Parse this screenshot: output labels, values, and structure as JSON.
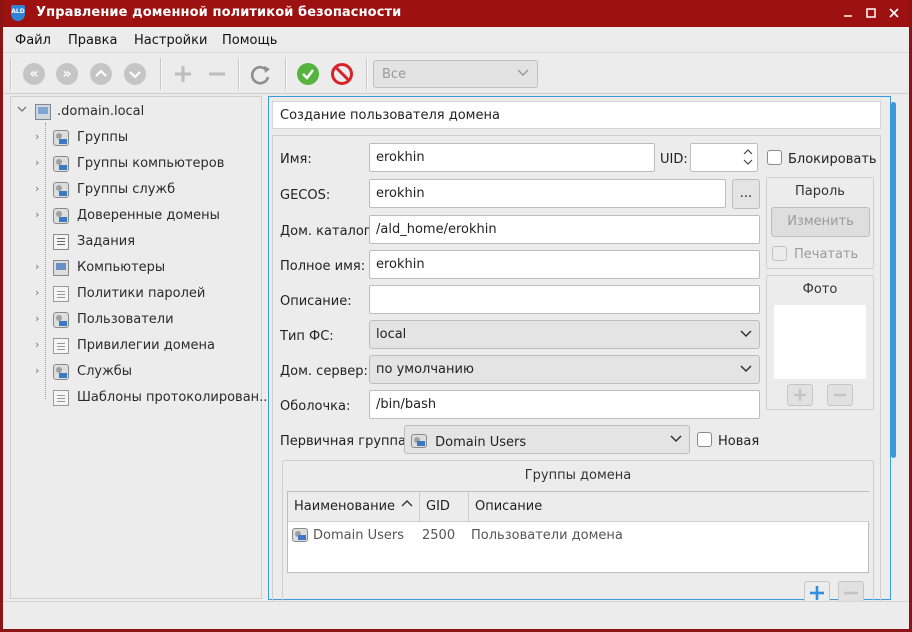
{
  "window": {
    "title": "Управление доменной политикой безопасности",
    "app_icon_text": "ALD"
  },
  "menu": [
    "Файл",
    "Правка",
    "Настройки",
    "Помощь"
  ],
  "toolbar": {
    "icons": [
      "first-icon",
      "last-icon",
      "up-icon",
      "down-icon",
      "add-icon",
      "remove-icon",
      "refresh-icon",
      "apply-icon",
      "cancel-icon"
    ],
    "filter_value": "Все"
  },
  "tree": {
    "root": ".domain.local",
    "items": [
      {
        "label": "Группы",
        "icon": "group-icon"
      },
      {
        "label": "Группы компьютеров",
        "icon": "computer-group-icon"
      },
      {
        "label": "Группы служб",
        "icon": "service-group-icon"
      },
      {
        "label": "Доверенные домены",
        "icon": "trusted-domain-icon"
      },
      {
        "label": "Задания",
        "icon": "task-icon"
      },
      {
        "label": "Компьютеры",
        "icon": "computer-icon"
      },
      {
        "label": "Политики паролей",
        "icon": "password-policy-icon"
      },
      {
        "label": "Пользователи",
        "icon": "users-icon"
      },
      {
        "label": "Привилегии домена",
        "icon": "privileges-icon"
      },
      {
        "label": "Службы",
        "icon": "services-icon"
      },
      {
        "label": "Шаблоны протоколирован...",
        "icon": "log-template-icon"
      }
    ]
  },
  "form": {
    "heading": "Создание пользователя домена",
    "name_label": "Имя:",
    "name_value": "erokhin",
    "uid_label": "UID:",
    "uid_value": "",
    "block_label": "Блокировать",
    "gecos_label": "GECOS:",
    "gecos_value": "erokhin",
    "gecos_button": "...",
    "home_label": "Дом. каталог:",
    "home_value": "/ald_home/erokhin",
    "fullname_label": "Полное имя:",
    "fullname_value": "erokhin",
    "desc_label": "Описание:",
    "desc_value": "",
    "fs_label": "Тип ФС:",
    "fs_value": "local",
    "server_label": "Дом. сервер:",
    "server_value": "по умолчанию",
    "shell_label": "Оболочка:",
    "shell_value": "/bin/bash",
    "primary_group_label": "Первичная группа:",
    "primary_group_value": "Domain Users",
    "new_label": "Новая"
  },
  "password_group": {
    "title": "Пароль",
    "change_button": "Изменить",
    "print_label": "Печатать"
  },
  "photo_group": {
    "title": "Фото"
  },
  "domain_groups": {
    "title": "Группы домена",
    "columns": [
      "Наименование",
      "GID",
      "Описание"
    ],
    "sort_indicator": "^",
    "rows": [
      {
        "name": "Domain Users",
        "gid": "2500",
        "description": "Пользователи домена"
      }
    ]
  }
}
